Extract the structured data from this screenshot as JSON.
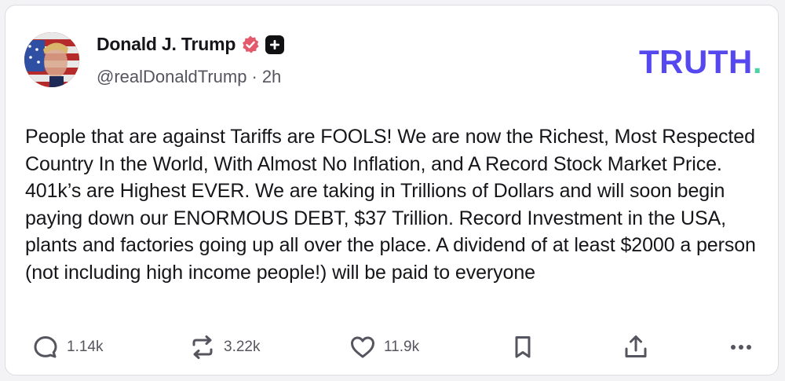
{
  "post": {
    "author_name": "Donald J. Trump",
    "handle": "@realDonaldTrump",
    "separator": "·",
    "time": "2h",
    "brand": "TRUTH",
    "brand_dot": ".",
    "text": "People that are against Tariffs are FOOLS! We are now the Richest, Most Respected Country In the World, With Almost No Inflation, and A Record Stock Market Price. 401k’s are Highest EVER. We are taking in Trillions of Dollars and will soon begin paying down our ENORMOUS DEBT, $37 Trillion. Record Investment in the USA, plants and factories going up all over the place. A dividend of at least $2000 a person (not including high income people!) will be paid to everyone"
  },
  "actions": {
    "reply_count": "1.14k",
    "retruth_count": "3.22k",
    "like_count": "11.9k",
    "icons": [
      "reply-icon",
      "retruth-icon",
      "like-icon",
      "bookmark-icon",
      "share-icon",
      "more-icon"
    ]
  },
  "colors": {
    "brand": "#5448ee",
    "brand_accent": "#4fd1a5",
    "verified": "#e25a6b",
    "icon": "#55555f"
  }
}
